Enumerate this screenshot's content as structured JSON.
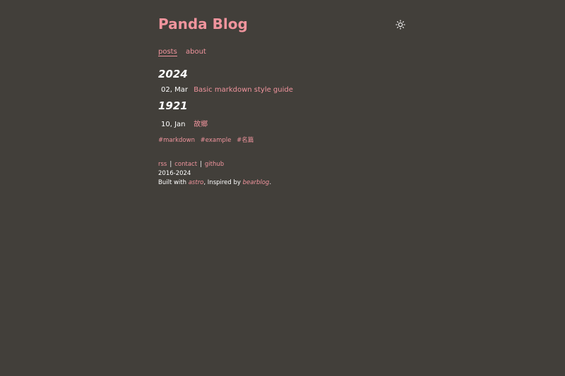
{
  "site": {
    "title": "Panda Blog",
    "theme_icon": "sun-icon"
  },
  "nav": {
    "items": [
      {
        "label": "posts",
        "active": true
      },
      {
        "label": "about",
        "active": false
      }
    ]
  },
  "posts_by_year": [
    {
      "year": "2024",
      "posts": [
        {
          "date": "02, Mar",
          "title": "Basic markdown style guide"
        }
      ]
    },
    {
      "year": "1921",
      "posts": [
        {
          "date": "10, Jan",
          "title": "故鄉"
        }
      ]
    }
  ],
  "tags": [
    "#markdown",
    "#example",
    "#名篇"
  ],
  "footer": {
    "links": [
      "rss",
      "contact",
      "github"
    ],
    "separator": "|",
    "years": "2016-2024",
    "built_prefix": "Built with ",
    "built_tool": "astro",
    "built_middle": ", Inspired by ",
    "built_inspiration": "bearblog",
    "built_suffix": "."
  },
  "colors": {
    "background": "#423f3a",
    "accent": "#f0949d",
    "text": "#ffffff"
  }
}
